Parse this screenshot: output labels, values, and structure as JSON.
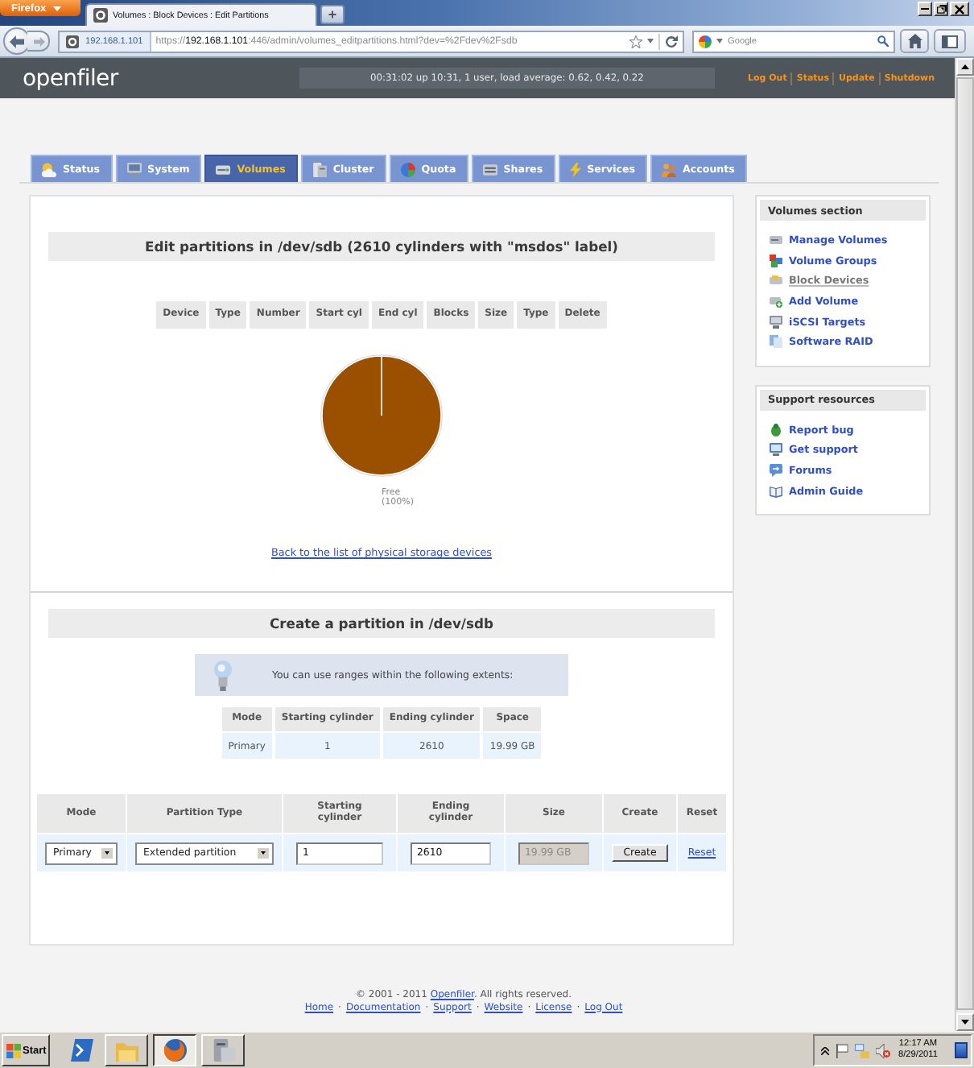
{
  "browser": {
    "menu_button": "Firefox",
    "tabs": [
      {
        "title": "Volumes : Block Devices : Edit Partitions",
        "selected": true
      }
    ],
    "new_tab": "+",
    "identity": "192.168.1.101",
    "url": "https://**192.168.1.101**:446/admin/volumes_editpartitions.html?dev=%2Fdev%2Fsdb",
    "search_placeholder": "Google"
  },
  "header": {
    "logo": "openfiler",
    "status": "00:31:02 up 10:31, 1 user, load average: 0.62, 0.42, 0.22",
    "links": [
      "Log Out",
      "Status",
      "Update",
      "Shutdown"
    ]
  },
  "nav_tabs": [
    {
      "label": "Status",
      "selected": false
    },
    {
      "label": "System",
      "selected": false
    },
    {
      "label": "Volumes",
      "selected": true
    },
    {
      "label": "Cluster",
      "selected": false
    },
    {
      "label": "Quota",
      "selected": false
    },
    {
      "label": "Shares",
      "selected": false
    },
    {
      "label": "Services",
      "selected": false
    },
    {
      "label": "Accounts",
      "selected": false
    }
  ],
  "partitions": {
    "title": "Edit partitions in /dev/sdb (2610 cylinders with \"msdos\" label)",
    "columns": [
      "Device",
      "Type",
      "Number",
      "Start cyl",
      "End cyl",
      "Blocks",
      "Size",
      "Type",
      "Delete"
    ],
    "chart_data": {
      "type": "pie",
      "categories": [
        "Free"
      ],
      "values": [
        100
      ],
      "value_labels": [
        "(100%)"
      ]
    },
    "back_link": "Back to the list of physical storage devices"
  },
  "create": {
    "title": "Create a partition in /dev/sdb",
    "notice": "You can use ranges within the following extents:",
    "extents": {
      "columns": [
        "Mode",
        "Starting cylinder",
        "Ending cylinder",
        "Space"
      ],
      "rows": [
        [
          "Primary",
          "1",
          "2610",
          "19.99 GB"
        ]
      ]
    },
    "form": {
      "columns": [
        "Mode",
        "Partition Type",
        "Starting cylinder",
        "Ending cylinder",
        "Size",
        "Create",
        "Reset"
      ],
      "fields": [
        {
          "kind": "select",
          "value": "Primary",
          "disabled": false
        },
        {
          "kind": "select",
          "value": "Extended partition",
          "disabled": false
        },
        {
          "kind": "input",
          "value": "1",
          "disabled": false
        },
        {
          "kind": "input",
          "value": "2610",
          "disabled": false
        },
        {
          "kind": "input",
          "value": "19.99 GB",
          "disabled": true
        },
        {
          "kind": "button",
          "value": "Create",
          "disabled": false
        },
        {
          "kind": "link",
          "value": "Reset",
          "disabled": false
        }
      ]
    }
  },
  "sidebar": [
    {
      "title": "Volumes section",
      "items": [
        {
          "label": "Manage Volumes",
          "selected": false
        },
        {
          "label": "Volume Groups",
          "selected": false
        },
        {
          "label": "Block Devices",
          "selected": true
        },
        {
          "label": "Add Volume",
          "selected": false
        },
        {
          "label": "iSCSI Targets",
          "selected": false
        },
        {
          "label": "Software RAID",
          "selected": false
        }
      ]
    },
    {
      "title": "Support resources",
      "items": [
        {
          "label": "Report bug",
          "selected": false
        },
        {
          "label": "Get support",
          "selected": false
        },
        {
          "label": "Forums",
          "selected": false
        },
        {
          "label": "Admin Guide",
          "selected": false
        }
      ]
    }
  ],
  "footer": {
    "copyright": {
      "before": "© 2001 - 2011 ",
      "link": "Openfiler",
      "after": ". All rights reserved."
    },
    "links": [
      {
        "kind": "link",
        "text": "Home"
      },
      {
        "kind": "separator",
        "text": "·"
      },
      {
        "kind": "link",
        "text": "Documentation"
      },
      {
        "kind": "separator",
        "text": "·"
      },
      {
        "kind": "link",
        "text": "Support"
      },
      {
        "kind": "separator",
        "text": "·"
      },
      {
        "kind": "link",
        "text": "Website"
      },
      {
        "kind": "separator",
        "text": "·"
      },
      {
        "kind": "link",
        "text": "License"
      },
      {
        "kind": "separator",
        "text": "·"
      },
      {
        "kind": "link",
        "text": "Log Out"
      }
    ]
  },
  "taskbar": {
    "start": "Start",
    "items": [
      {
        "kind": "launcher",
        "selected": false
      },
      {
        "kind": "window",
        "selected": false
      },
      {
        "kind": "window",
        "selected": true
      },
      {
        "kind": "window",
        "selected": false
      }
    ],
    "time": "12:17 AM",
    "date": "8/29/2011"
  }
}
